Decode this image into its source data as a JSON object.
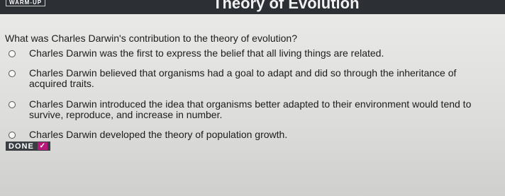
{
  "header": {
    "badge": "WARM-UP",
    "title": "Theory of Evolution"
  },
  "question": {
    "text": "What was Charles Darwin's contribution to the theory of evolution?",
    "options": [
      {
        "label": "Charles Darwin was the first to express the belief that all living things are related."
      },
      {
        "label": "Charles Darwin believed that organisms had a goal to adapt and did so through the inheritance of acquired traits."
      },
      {
        "label": "Charles Darwin introduced the idea that organisms better adapted to their environment would tend to survive, reproduce, and increase in number."
      },
      {
        "label": "Charles Darwin developed the theory of population growth."
      }
    ]
  },
  "done_button": {
    "label": "DONE",
    "icon": "checkmark-icon",
    "accent": "#b5197a"
  }
}
